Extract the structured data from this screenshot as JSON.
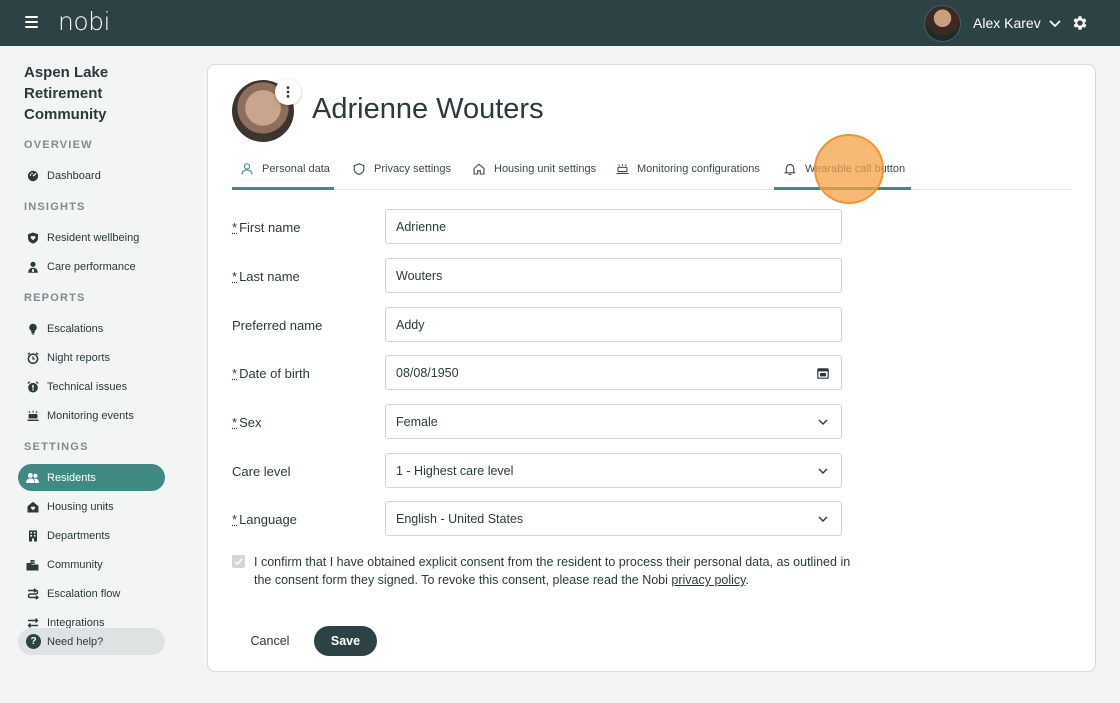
{
  "topbar": {
    "logo": "nobi",
    "user_name": "Alex Karev",
    "icons": {
      "menu": "hamburger-menu-icon",
      "dropdown": "chevron-down-icon",
      "settings": "gear-icon"
    }
  },
  "sidebar": {
    "community": "Aspen Lake Retirement Community",
    "sections": {
      "overview": "OVERVIEW",
      "insights": "INSIGHTS",
      "reports": "REPORTS",
      "settings": "SETTINGS"
    },
    "items": {
      "dashboard": "Dashboard",
      "resident_wellbeing": "Resident wellbeing",
      "care_performance": "Care performance",
      "escalations": "Escalations",
      "night_reports": "Night reports",
      "technical_issues": "Technical issues",
      "monitoring_events": "Monitoring events",
      "residents": "Residents",
      "housing_units": "Housing units",
      "departments": "Departments",
      "community": "Community",
      "escalation_flow": "Escalation flow",
      "integrations": "Integrations"
    },
    "active_item": "Residents",
    "help": "Need help?"
  },
  "resident": {
    "name": "Adrienne Wouters"
  },
  "tabs": {
    "personal_data": "Personal data",
    "privacy_settings": "Privacy settings",
    "housing_unit_settings": "Housing unit settings",
    "monitoring_configurations": "Monitoring configurations",
    "wearable_call_button": "Wearable call button"
  },
  "form": {
    "required_mark": "*",
    "first_name": {
      "label": "First name",
      "value": "Adrienne"
    },
    "last_name": {
      "label": "Last name",
      "value": "Wouters"
    },
    "preferred_name": {
      "label": "Preferred name",
      "value": "Addy"
    },
    "date_of_birth": {
      "label": "Date of birth",
      "value": "08/08/1950"
    },
    "sex": {
      "label": "Sex",
      "value": "Female"
    },
    "care_level": {
      "label": "Care level",
      "value": "1 - Highest care level"
    },
    "language": {
      "label": "Language",
      "value": "English - United States"
    },
    "consent_text": "I confirm that I have obtained explicit consent from the resident to process their personal data, as outlined in the consent form they signed. To revoke this consent, please read the Nobi",
    "privacy_link": "privacy policy",
    "consent_end": ".",
    "consent_checked": true
  },
  "actions": {
    "cancel": "Cancel",
    "save": "Save"
  },
  "colors": {
    "topbar": "#2d4245",
    "accent": "#3f8b83",
    "click_indicator": "#f7a248"
  }
}
